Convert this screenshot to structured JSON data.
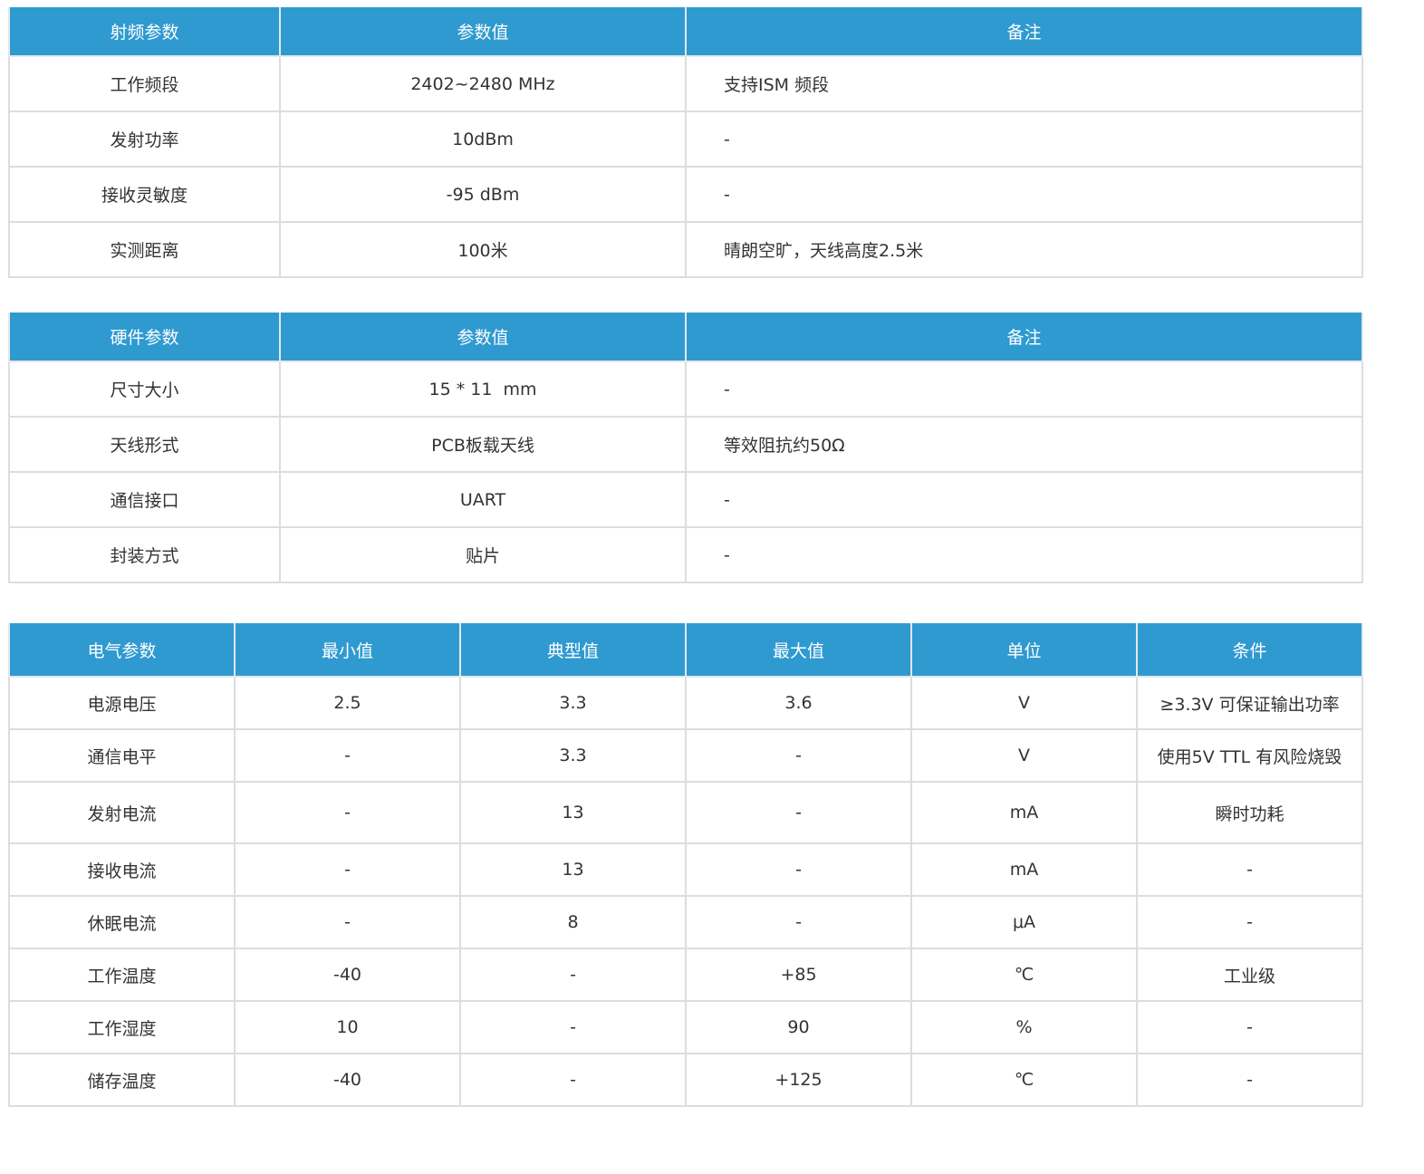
{
  "rf_table": {
    "headers": [
      "射频参数",
      "参数值",
      "备注"
    ],
    "rows": [
      [
        "工作频段",
        "2402~2480 MHz",
        "支持ISM 频段"
      ],
      [
        "发射功率",
        "10dBm",
        "-"
      ],
      [
        "接收灵敏度",
        "-95 dBm",
        "-"
      ],
      [
        "实测距离",
        "100米",
        "晴朗空旷，天线高度2.5米"
      ]
    ]
  },
  "hw_table": {
    "headers": [
      "硬件参数",
      "参数值",
      "备注"
    ],
    "rows": [
      [
        "尺寸大小",
        "15 * 11  mm",
        "-"
      ],
      [
        "天线形式",
        "PCB板载天线",
        "等效阻抗约50Ω"
      ],
      [
        "通信接口",
        "UART",
        "-"
      ],
      [
        "封装方式",
        "贴片",
        "-"
      ]
    ]
  },
  "electrical_table": {
    "headers": [
      "电气参数",
      "最小值",
      "典型值",
      "最大值",
      "单位",
      "条件"
    ],
    "rows": [
      [
        "电源电压",
        "2.5",
        "3.3",
        "3.6",
        "V",
        "≥3.3V 可保证输出功率"
      ],
      [
        "通信电平",
        "-",
        "3.3",
        "-",
        "V",
        "使用5V TTL 有风险烧毁"
      ],
      [
        "发射电流",
        "-",
        "13",
        "-",
        "mA",
        "瞬时功耗"
      ],
      [
        "接收电流",
        "-",
        "13",
        "-",
        "mA",
        "-"
      ],
      [
        "休眠电流",
        "-",
        "8",
        "-",
        "μA",
        "-"
      ],
      [
        "工作温度",
        "-40",
        "-",
        "+85",
        "℃",
        "工业级"
      ],
      [
        "工作湿度",
        "10",
        "-",
        "90",
        "%",
        "-"
      ],
      [
        "储存温度",
        "-40",
        "-",
        "+125",
        "℃",
        "-"
      ]
    ]
  },
  "colors": {
    "header_bg": "#2f9ad0",
    "header_text": "#ffffff",
    "border": "#dddddd",
    "body_text": "#333333"
  }
}
